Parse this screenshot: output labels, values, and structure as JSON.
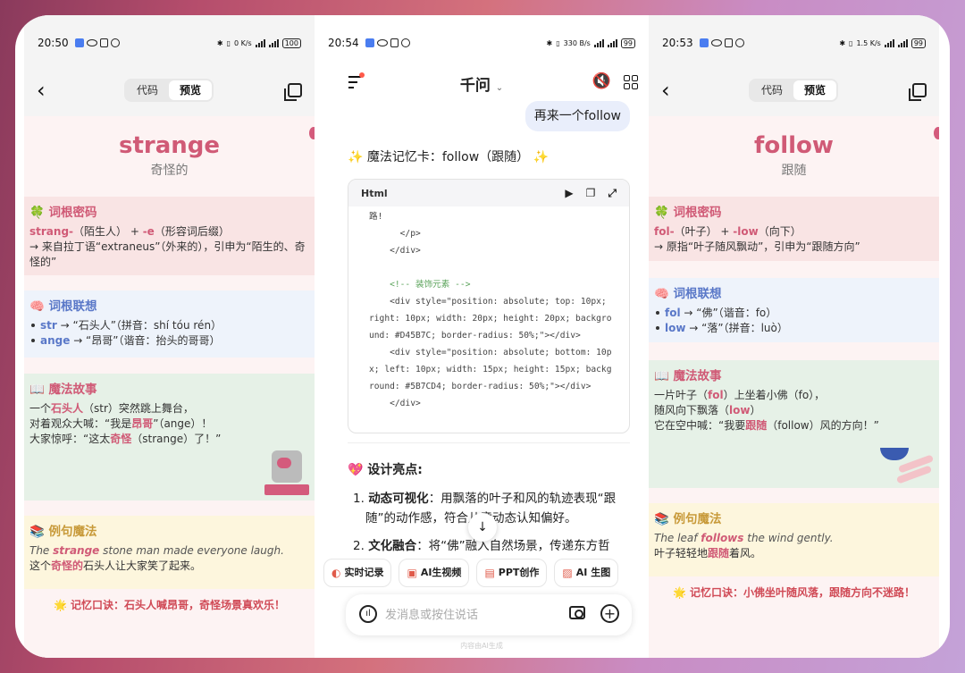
{
  "phone1": {
    "status": {
      "time": "20:50",
      "net": "0 K/s",
      "battery": "100"
    },
    "nav": {
      "back": "‹",
      "tab_code": "代码",
      "tab_preview": "预览"
    },
    "card": {
      "word": "strange",
      "meaning": "奇怪的",
      "root": {
        "title": "🍀 词根密码",
        "line1_a": "strang-",
        "line1_b": "（陌生人） + ",
        "line1_c": "-e",
        "line1_d": "（形容词后缀）",
        "line2": "→ 来自拉丁语“extraneus”（外来的），引申为“陌生的、奇怪的”"
      },
      "assoc": {
        "title": "🧠 词根联想",
        "items": [
          {
            "key": "str",
            "text": " → “石头人”（拼音：shí tóu rén）"
          },
          {
            "key": "ange",
            "text": " → “昂哥”（谐音：抬头的哥哥）"
          }
        ]
      },
      "story": {
        "title": "📖 魔法故事",
        "l1a": "一个",
        "l1b": "石头人",
        "l1c": "（str）突然跳上舞台，",
        "l2a": "对着观众大喊：“我是",
        "l2b": "昂哥",
        "l2c": "”（ange）！",
        "l3a": "大家惊呼：“这太",
        "l3b": "奇怪",
        "l3c": "（strange）了！”"
      },
      "example": {
        "title": "📚 例句魔法",
        "en_a": "The ",
        "en_b": "strange",
        "en_c": " stone man made everyone laugh.",
        "zh_a": "这个",
        "zh_b": "奇怪的",
        "zh_c": "石头人让大家笑了起来。"
      },
      "motto": "🌟 记忆口诀：石头人喊昂哥，奇怪场景真欢乐！"
    }
  },
  "phone2": {
    "status": {
      "time": "20:54",
      "net": "330 B/s",
      "battery": "99"
    },
    "app_title": "千问",
    "app_title_caret": "⌄",
    "user_message": "再来一个follow",
    "ai_heading": "✨ 魔法记忆卡：follow（跟随） ✨",
    "code_block": {
      "lang": "Html",
      "lines": [
        "路!",
        "      </p>",
        "    </div>",
        "",
        "    <!-- 装饰元素 -->",
        "    <div style=\"position: absolute; top: 10px; right: 10px; width: 20px; height: 20px; background: #D45B7C; border-radius: 50%;\"></div>",
        "    <div style=\"position: absolute; bottom: 10px; left: 10px; width: 15px; height: 15px; background: #5B7CD4; border-radius: 50%;\"></div>",
        "    </div>"
      ]
    },
    "highlights_title": "💖 设计亮点:",
    "highlights": [
      {
        "num": "1.",
        "bold": "动态可视化",
        "text": "：用飘落的叶子和风的轨迹表现“跟随”的动作感，符合儿童动态认知偏好。"
      },
      {
        "num": "2.",
        "bold": "文化融合",
        "text": "：将“佛”融入自然场景，传递东方哲"
      }
    ],
    "chips": [
      "实时记录",
      "AI生视频",
      "PPT创作",
      "AI 生图"
    ],
    "input": {
      "placeholder": "发消息或按住说话"
    },
    "footer_note": "内容由AI生成"
  },
  "phone3": {
    "status": {
      "time": "20:53",
      "net": "1.5 K/s",
      "battery": "99"
    },
    "nav": {
      "back": "‹",
      "tab_code": "代码",
      "tab_preview": "预览"
    },
    "card": {
      "word": "follow",
      "meaning": "跟随",
      "root": {
        "title": "🍀 词根密码",
        "line1_a": "fol-",
        "line1_b": "（叶子） + ",
        "line1_c": "-low",
        "line1_d": "（向下）",
        "line2": "→ 原指“叶子随风飘动”，引申为“跟随方向”"
      },
      "assoc": {
        "title": "🧠 词根联想",
        "items": [
          {
            "key": "fol",
            "text": " → “佛”（谐音：fo）"
          },
          {
            "key": "low",
            "text": " → “落”（拼音：luò）"
          }
        ]
      },
      "story": {
        "title": "📖 魔法故事",
        "l1a": "一片叶子（",
        "l1b": "fol",
        "l1c": "）上坐着小佛（fo），",
        "l2a": "随风向下飘落（",
        "l2b": "low",
        "l2c": "）",
        "l3a": "它在空中喊：“我要",
        "l3b": "跟随",
        "l3c": "（follow）风的方向！”"
      },
      "example": {
        "title": "📚 例句魔法",
        "en_a": "The leaf ",
        "en_b": "follows",
        "en_c": " the wind gently.",
        "zh_a": "叶子轻轻地",
        "zh_b": "跟随",
        "zh_c": "着风。"
      },
      "motto": "🌟 记忆口诀：小佛坐叶随风落，跟随方向不迷路！"
    }
  }
}
